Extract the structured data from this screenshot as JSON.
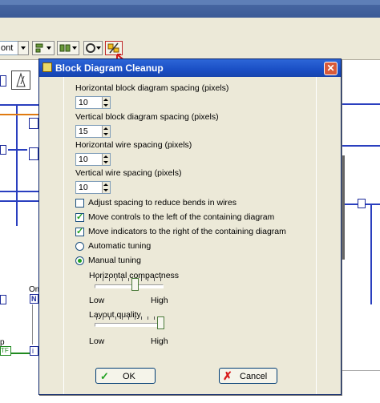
{
  "toolbar": {
    "font_value": "ont"
  },
  "dialog": {
    "title": "Block Diagram Cleanup",
    "horizontal_block_spacing": {
      "label": "Horizontal block diagram spacing (pixels)",
      "value": "10"
    },
    "vertical_block_spacing": {
      "label": "Vertical block diagram spacing (pixels)",
      "value": "15"
    },
    "horizontal_wire_spacing": {
      "label": "Horizontal wire spacing (pixels)",
      "value": "10"
    },
    "vertical_wire_spacing": {
      "label": "Vertical wire spacing (pixels)",
      "value": "10"
    },
    "options": [
      {
        "label": "Adjust spacing to reduce bends in wires",
        "checked": false
      },
      {
        "label": "Move controls to the left of the containing diagram",
        "checked": true
      },
      {
        "label": "Move indicators to the right of the containing diagram",
        "checked": true
      }
    ],
    "tuning": {
      "automatic_label": "Automatic tuning",
      "manual_label": "Manual tuning",
      "selected": "manual"
    },
    "compactness": {
      "label": "Horizontal compactness",
      "low": "Low",
      "high": "High",
      "level": 0.6
    },
    "quality": {
      "label": "Layout quality",
      "low": "Low",
      "high": "High",
      "level": 1.0
    },
    "ok_label": "OK",
    "cancel_label": "Cancel"
  },
  "diagram": {
    "label_om": "Om",
    "label_n": "N",
    "label_i": "i",
    "label_tf": "TF",
    "label_p": "p"
  },
  "colors": {
    "accent": "#2d67d8",
    "wire": "#2a3fbf",
    "check": "#21a121"
  }
}
